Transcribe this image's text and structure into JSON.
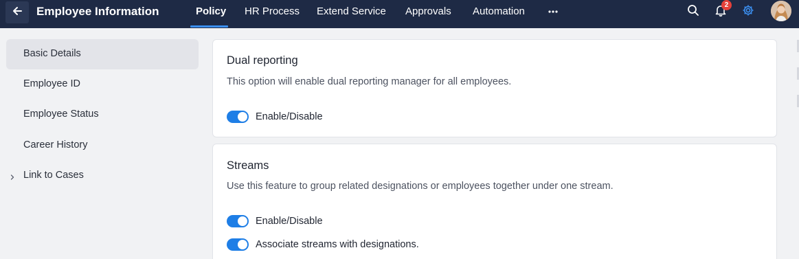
{
  "header": {
    "title": "Employee Information",
    "back_icon": "arrow-left-icon",
    "tabs": [
      {
        "label": "Policy",
        "active": true
      },
      {
        "label": "HR Process",
        "active": false
      },
      {
        "label": "Extend Service",
        "active": false
      },
      {
        "label": "Approvals",
        "active": false
      },
      {
        "label": "Automation",
        "active": false
      }
    ],
    "more_icon": "more-horizontal-icon",
    "search_icon": "search-icon",
    "notifications": {
      "icon": "bell-icon",
      "count": "2"
    },
    "settings_icon": "gear-icon",
    "avatar_icon": "user-avatar",
    "colors": {
      "bar": "#1e2a45",
      "accent": "#3b8ff0",
      "badge": "#e5413a"
    }
  },
  "sidebar": {
    "items": [
      {
        "label": "Basic Details",
        "active": true
      },
      {
        "label": "Employee ID",
        "active": false
      },
      {
        "label": "Employee Status",
        "active": false
      },
      {
        "label": "Career History",
        "active": false
      },
      {
        "label": "Link to Cases",
        "active": false,
        "expandable": true
      }
    ]
  },
  "main": {
    "dual_reporting": {
      "title": "Dual reporting",
      "description": "This option will enable dual reporting manager for all employees.",
      "toggles": [
        {
          "label": "Enable/Disable",
          "on": true
        }
      ]
    },
    "streams": {
      "title": "Streams",
      "description": "Use this feature to group related designations or employees together under one stream.",
      "toggles": [
        {
          "label": "Enable/Disable",
          "on": true
        },
        {
          "label": "Associate streams with designations.",
          "on": true
        }
      ]
    },
    "toggle_color": "#1e7ee6"
  }
}
